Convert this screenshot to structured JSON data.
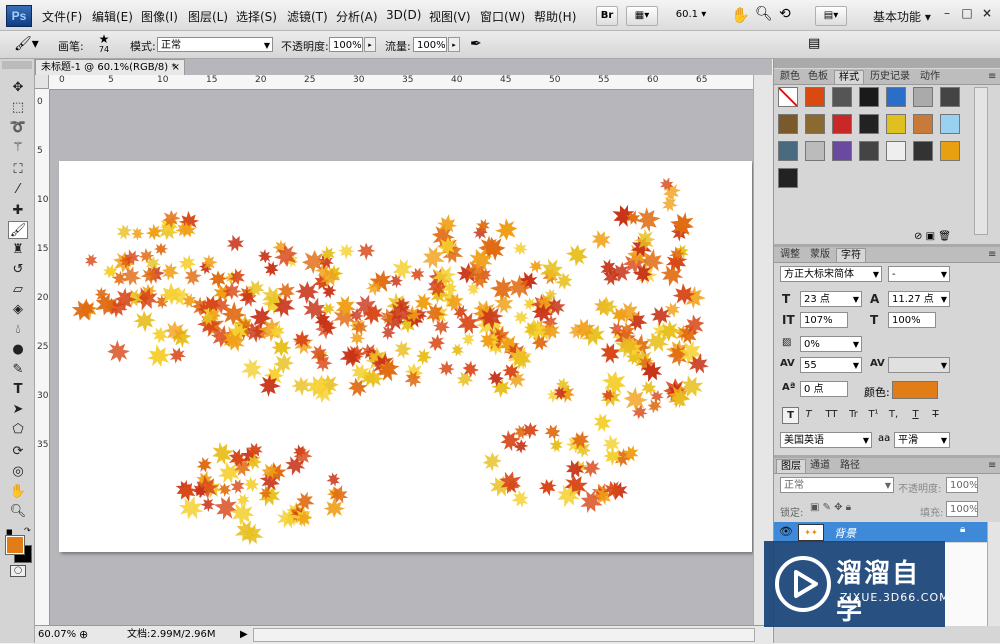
{
  "menu": {
    "logo": "Ps",
    "items": [
      "文件(F)",
      "编辑(E)",
      "图像(I)",
      "图层(L)",
      "选择(S)",
      "滤镜(T)",
      "分析(A)",
      "3D(D)",
      "视图(V)",
      "窗口(W)",
      "帮助(H)"
    ],
    "bridge_label": "Br",
    "zoom_value": "60.1",
    "workspace": "基本功能",
    "win_min": "–",
    "win_max": "□",
    "win_close": "×"
  },
  "options": {
    "brush_label": "画笔:",
    "brush_size": "74",
    "mode_label": "模式:",
    "mode_value": "正常",
    "opacity_label": "不透明度:",
    "opacity_value": "100%",
    "flow_label": "流量:",
    "flow_value": "100%"
  },
  "document": {
    "tab_title": "未标题-1 @ 60.1%(RGB/8) *",
    "tab_close": "×",
    "ruler_h": [
      "0",
      "5",
      "10",
      "15",
      "20",
      "25",
      "30",
      "35",
      "40",
      "45",
      "50",
      "55",
      "60",
      "65"
    ],
    "ruler_v": [
      "0",
      "5",
      "10",
      "15",
      "20",
      "25",
      "30",
      "35"
    ]
  },
  "status": {
    "zoom": "60.07%",
    "doc_info": "文档:2.99M/2.96M"
  },
  "panels": {
    "top_tabs": [
      "颜色",
      "色板",
      "样式",
      "历史记录",
      "动作"
    ],
    "top_active": "样式",
    "char_tabs": [
      "调整",
      "蒙版",
      "字符"
    ],
    "char_active": "字符",
    "font_family": "方正大标宋简体",
    "font_style": "-",
    "font_size": "23 点",
    "leading": "11.27 点",
    "vertical_scale": "107%",
    "horizontal_scale": "100%",
    "tsume": "0%",
    "tracking": "55",
    "baseline": "0 点",
    "color_label": "颜色:",
    "color_value": "#e07d16",
    "format_buttons": [
      "T",
      "T",
      "TT",
      "Tr",
      "T¹",
      "T,",
      "T",
      "T"
    ],
    "language": "美国英语",
    "aa_label": "aa",
    "antialias": "平滑",
    "layer_tabs": [
      "图层",
      "通道",
      "路径"
    ],
    "layer_active": "图层",
    "blend_mode": "正常",
    "layer_opacity_label": "不透明度:",
    "layer_opacity": "100%",
    "lock_label": "锁定:",
    "fill_label": "填充:",
    "fill_value": "100%",
    "layer_name": "背景"
  },
  "watermark": {
    "title": "溜溜自学",
    "url": "ZIXUE.3D66.COM"
  },
  "colors": {
    "foreground": "#e07d16",
    "background": "#000000",
    "leaf_colors": [
      "#f0a018",
      "#e8c020",
      "#e06a10",
      "#d84818",
      "#c83418",
      "#f5d030"
    ]
  }
}
